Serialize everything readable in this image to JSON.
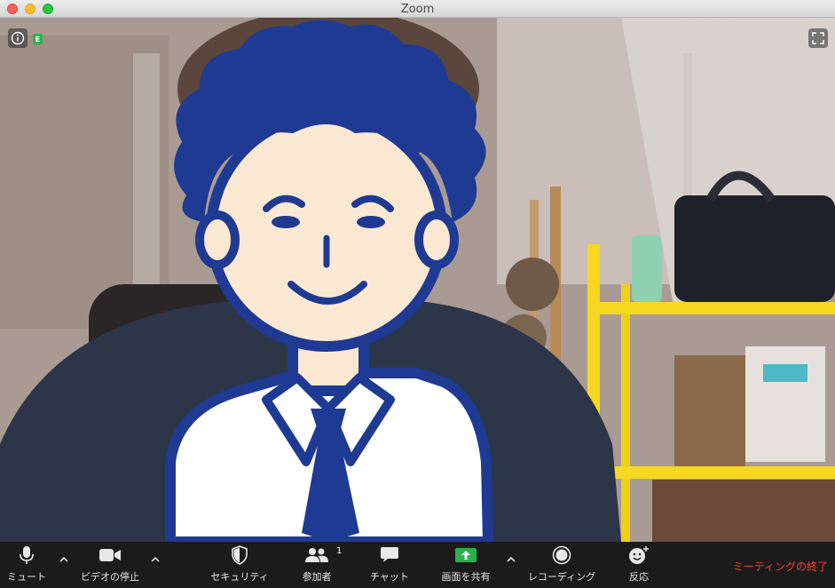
{
  "window": {
    "title": "Zoom"
  },
  "toolbar": {
    "mute": "ミュート",
    "stop_video": "ビデオの停止",
    "security": "セキュリティ",
    "participants": "参加者",
    "participants_count": "1",
    "chat": "チャット",
    "share_screen": "画面を共有",
    "recording": "レコーディング",
    "reactions": "反応",
    "end_meeting": "ミーティングの終了"
  },
  "badges": {
    "encryption": "E"
  },
  "colors": {
    "end_meeting": "#ff3b30",
    "share_green": "#2bb24c",
    "avatar_blue": "#1f3a93",
    "avatar_skin": "#fbe8d2"
  }
}
